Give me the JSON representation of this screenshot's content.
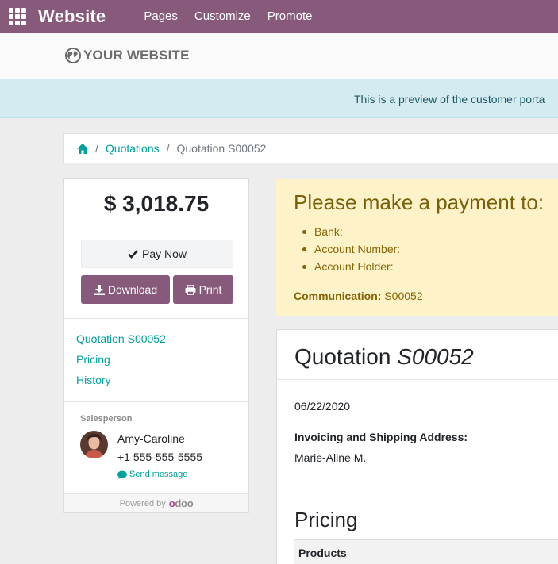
{
  "topbar": {
    "brand": "Website",
    "nav": [
      "Pages",
      "Customize",
      "Promote"
    ],
    "color": "#875a7b"
  },
  "site": {
    "logo_text": "YOUR WEBSITE"
  },
  "banner": {
    "text": "This is a preview of the customer porta"
  },
  "breadcrumb": {
    "items": [
      "Quotations",
      "Quotation S00052"
    ],
    "separator": "/"
  },
  "sidebar": {
    "amount": "$ 3,018.75",
    "pay_now_label": "Pay Now",
    "download_label": "Download",
    "print_label": "Print",
    "links": [
      "Quotation S00052",
      "Pricing",
      "History"
    ],
    "salesperson_label": "Salesperson",
    "salesperson_name": "Amy-Caroline",
    "salesperson_phone": "+1 555-555-5555",
    "send_message_label": "Send message",
    "powered_by_label": "Powered by",
    "powered_by_logo": "odoo"
  },
  "payment": {
    "title": "Please make a payment to:",
    "items": [
      "Bank:",
      "Account Number:",
      "Account Holder:"
    ],
    "communication_label": "Communication:",
    "communication_value": "S00052"
  },
  "quote": {
    "title_prefix": "Quotation",
    "title_number": "S00052",
    "date": "06/22/2020",
    "address_label": "Invoicing and Shipping Address:",
    "address_name": "Marie-Aline M.",
    "pricing_title": "Pricing",
    "table_header": "Products"
  }
}
